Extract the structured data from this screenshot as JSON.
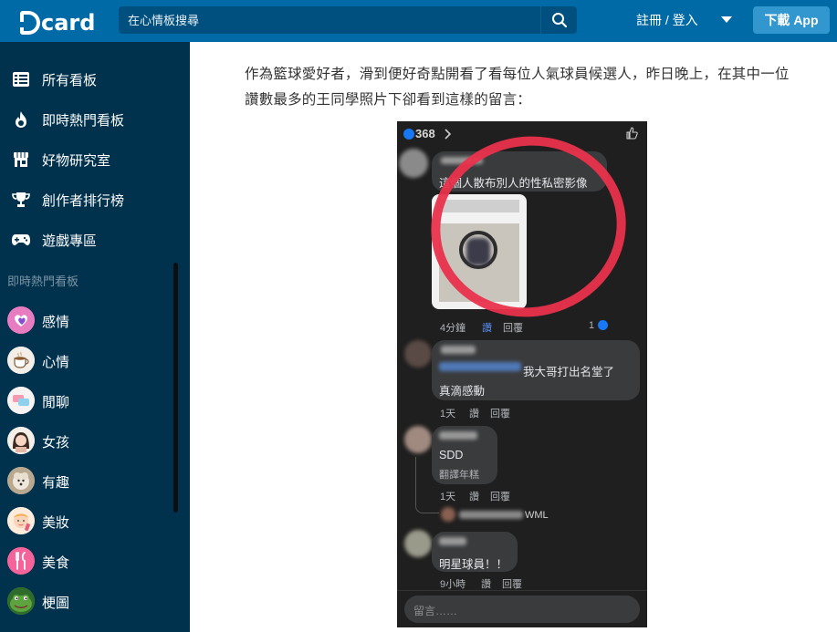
{
  "header": {
    "logo_text": "card",
    "search_placeholder": "在心情板搜尋",
    "login_label": "註冊 / 登入",
    "download_label": "下載 App",
    "brand_color": "#006aa6"
  },
  "sidebar": {
    "nav_items": [
      {
        "label": "所有看板",
        "icon": "list-icon"
      },
      {
        "label": "即時熱門看板",
        "icon": "flame-icon"
      },
      {
        "label": "好物研究室",
        "icon": "store-icon"
      },
      {
        "label": "創作者排行榜",
        "icon": "trophy-icon"
      },
      {
        "label": "遊戲專區",
        "icon": "gamepad-icon"
      }
    ],
    "section_title": "即時熱門看板",
    "boards": [
      {
        "label": "感情",
        "icon": "heart-avatar-icon"
      },
      {
        "label": "心情",
        "icon": "coffee-avatar-icon"
      },
      {
        "label": "閒聊",
        "icon": "chat-avatar-icon"
      },
      {
        "label": "女孩",
        "icon": "girl-avatar-icon"
      },
      {
        "label": "有趣",
        "icon": "dog-avatar-icon"
      },
      {
        "label": "美妝",
        "icon": "makeup-avatar-icon"
      },
      {
        "label": "美食",
        "icon": "utensils-avatar-icon"
      },
      {
        "label": "梗圖",
        "icon": "frog-avatar-icon"
      }
    ]
  },
  "article": {
    "text": "作為籃球愛好者，滑到便好奇點開看了看每位人氣球員候選人，昨日晚上，在其中一位讚數最多的王同學照片下卻看到這樣的留言："
  },
  "screenshot": {
    "reaction_count": "368",
    "comment1_text": "這個人散布別人的性私密影像",
    "comment1_time": "4分鐘",
    "comment1_like": "讚",
    "comment1_reply": "回覆",
    "comment1_count": "1",
    "comment2_text_a": "我大哥打出名堂了",
    "comment2_text_b": "真滴感動",
    "comment2_time": "1天",
    "comment2_like": "讚",
    "comment2_reply": "回覆",
    "comment3_text": "SDD",
    "comment3_sub": "翻譯年糕",
    "comment3_time": "1天",
    "comment3_like": "讚",
    "comment3_reply": "回覆",
    "reply_preview": "WML",
    "comment4_text": "明星球員！！",
    "comment4_time": "9小時",
    "comment4_like": "讚",
    "comment4_reply": "回覆",
    "composer_placeholder": "留言……",
    "highlight_color": "#e9324b"
  }
}
